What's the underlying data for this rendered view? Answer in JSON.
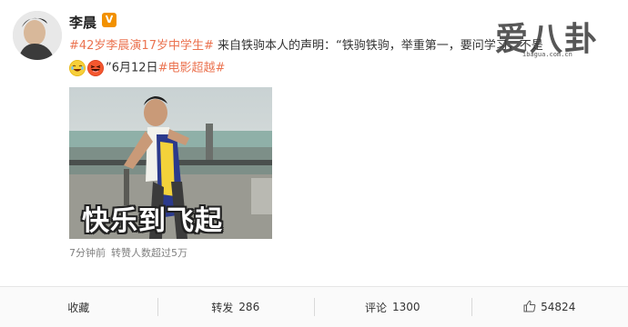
{
  "post": {
    "author": "李晨",
    "verified_badge": "V",
    "text": {
      "topic1": "#42岁李晨演17岁中学生#",
      "body": " 来自铁驹本人的声明：“铁驹铁驹，举重第一，要问学习，不是",
      "line2_date": "”6月12日",
      "topic2": "#电影超越#"
    },
    "emojis": [
      "laugh-crying-emoji",
      "laughing-emoji"
    ],
    "image_caption": "快乐到飞起",
    "meta": {
      "time": "7分钟前",
      "reposts_note": "转赞人数超过5万"
    }
  },
  "watermark": {
    "text": "爱八卦",
    "sub": "ibagua.com.cn"
  },
  "actions": {
    "collect": "收藏",
    "repost_label": "转发",
    "repost_count": "286",
    "comment_label": "评论",
    "comment_count": "1300",
    "like_count": "54824"
  },
  "colors": {
    "topic": "#eb7350",
    "badge": "#f29100",
    "background": "#f2f2f5"
  }
}
